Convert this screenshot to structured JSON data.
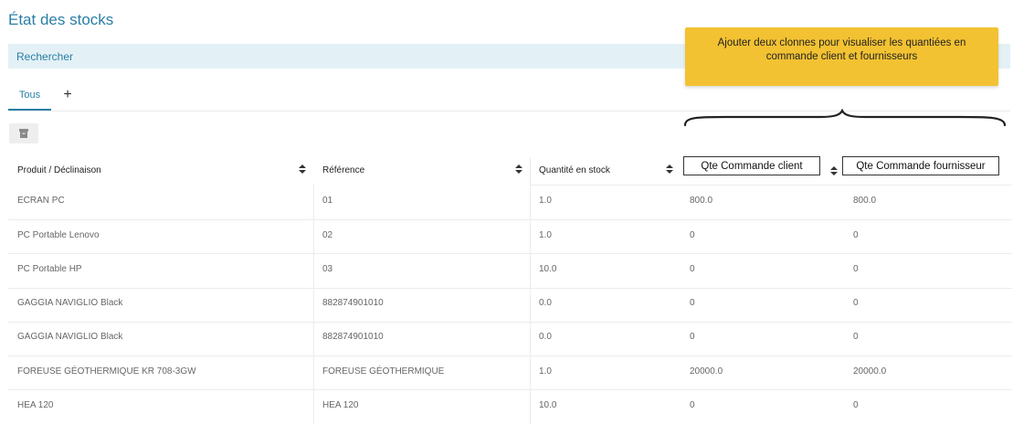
{
  "page": {
    "title": "État des stocks"
  },
  "search": {
    "label": "Rechercher"
  },
  "tabs": {
    "all_label": "Tous",
    "add_label": "+"
  },
  "annotation": {
    "callout_text": "Ajouter deux clonnes pour visualiser les quantiées en commande client et fournisseurs",
    "new_columns": [
      "Qte Commande client",
      "Qte Commande fournisseur"
    ]
  },
  "icons": {
    "archive": "archive-icon",
    "sort": "sort-icon",
    "brace": "curly-brace-icon"
  },
  "colors": {
    "accent": "#2a7fa5",
    "search_bg": "#e3f1f6",
    "callout_bg": "#f3c232"
  },
  "table": {
    "headers": [
      "Produit / Déclinaison",
      "Référence",
      "Quantité en stock"
    ],
    "rows": [
      {
        "product": "ECRAN PC",
        "reference": "01",
        "stock": "1.0",
        "client_qty": "800.0",
        "supplier_qty": "800.0"
      },
      {
        "product": "PC Portable Lenovo",
        "reference": "02",
        "stock": "1.0",
        "client_qty": "0",
        "supplier_qty": "0"
      },
      {
        "product": "PC Portable HP",
        "reference": "03",
        "stock": "10.0",
        "client_qty": "0",
        "supplier_qty": "0"
      },
      {
        "product": "GAGGIA NAVIGLIO Black",
        "reference": "882874901010",
        "stock": "0.0",
        "client_qty": "0",
        "supplier_qty": "0"
      },
      {
        "product": "GAGGIA NAVIGLIO Black",
        "reference": "882874901010",
        "stock": "0.0",
        "client_qty": "0",
        "supplier_qty": "0"
      },
      {
        "product": "FOREUSE GÉOTHERMIQUE KR 708-3GW",
        "reference": "FOREUSE GÉOTHERMIQUE",
        "stock": "1.0",
        "client_qty": "20000.0",
        "supplier_qty": "20000.0"
      },
      {
        "product": "HEA 120",
        "reference": "HEA 120",
        "stock": "10.0",
        "client_qty": "0",
        "supplier_qty": "0"
      }
    ]
  }
}
